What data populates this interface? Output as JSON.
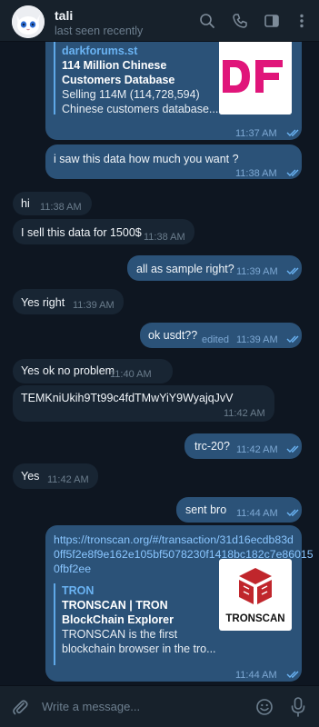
{
  "header": {
    "name": "tali",
    "status": "last seen recently"
  },
  "messages": [
    {
      "dir": "out",
      "preview": {
        "site": "darkforums.st",
        "title_lines": [
          "114 Million Chinese",
          "Customers Database"
        ],
        "desc_lines": [
          "Selling 114M (114,728,594)",
          "Chinese customers database...."
        ],
        "image_text": "DF"
      },
      "time": "11:37 AM"
    },
    {
      "dir": "out",
      "text": "i saw this data how much you want ?",
      "time": "11:38 AM"
    },
    {
      "dir": "in",
      "text": "hi",
      "time": "11:38 AM"
    },
    {
      "dir": "in",
      "text": "I sell this data for 1500$",
      "time": "11:38 AM"
    },
    {
      "dir": "out",
      "text": "all as sample right?",
      "time": "11:39 AM"
    },
    {
      "dir": "in",
      "text": "Yes right",
      "time": "11:39 AM"
    },
    {
      "dir": "out",
      "text": "ok usdt??",
      "time": "11:39 AM",
      "edited": "edited"
    },
    {
      "dir": "in",
      "text": "Yes ok no problem",
      "time": "11:40 AM"
    },
    {
      "dir": "in",
      "text": "TEMKniUkih9Tt99c4fdTMwYiY9WyajqJvV",
      "time": "11:42 AM"
    },
    {
      "dir": "out",
      "text": "trc-20?",
      "time": "11:42 AM"
    },
    {
      "dir": "in",
      "text": "Yes",
      "time": "11:42 AM"
    },
    {
      "dir": "out",
      "text": "sent bro",
      "time": "11:44 AM"
    },
    {
      "dir": "out",
      "link_lines": [
        "https://tronscan.org/#/transaction/31d16ecdb83d",
        "0ff5f2e8f9e162e105bf5078230f1418bc182c7e86015",
        "0fbf2ee"
      ],
      "preview": {
        "site": "TRON",
        "title_lines": [
          "TRONSCAN | TRON",
          "BlockChain Explorer"
        ],
        "desc_lines": [
          "TRONSCAN is the first",
          "blockchain browser in the tro..."
        ],
        "image_text": "TRONSCAN"
      },
      "time": "11:44 AM"
    }
  ],
  "composer": {
    "placeholder": "Write a message..."
  },
  "colors": {
    "background": "#0e1621",
    "header": "#17212b",
    "incoming_bubble": "#182533",
    "outgoing_bubble": "#2b5278",
    "link": "#6ab3f3",
    "df_logo": "#e0157a",
    "tronscan_logo": "#c0262c"
  },
  "icons": [
    "search-icon",
    "phone-icon",
    "sidebar-icon",
    "more-icon",
    "double-check-icon",
    "attach-icon",
    "emoji-icon",
    "mic-icon"
  ]
}
